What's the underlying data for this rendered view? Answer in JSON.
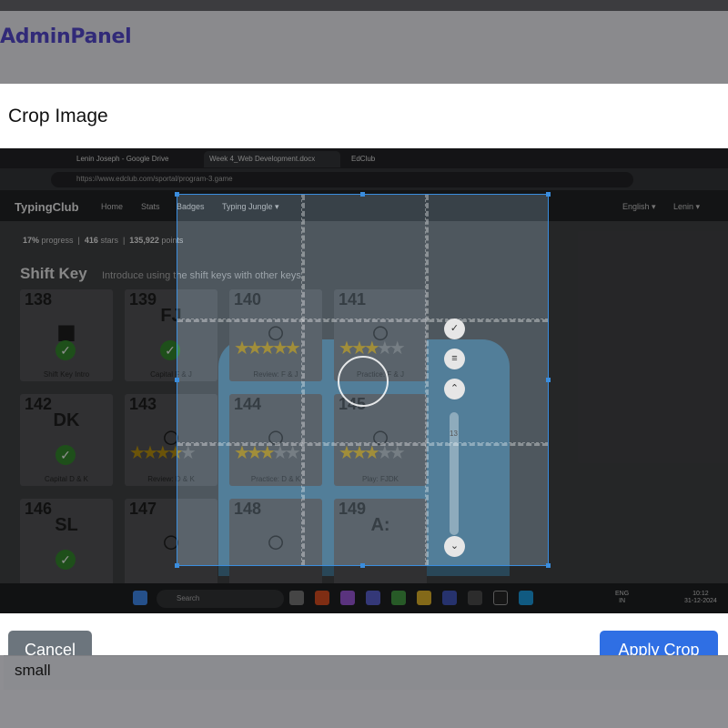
{
  "admin": {
    "brand": "AdminPanel"
  },
  "modal": {
    "title": "Crop Image",
    "cancel_label": "Cancel",
    "apply_label": "Apply Crop"
  },
  "background_field": {
    "value": "small"
  },
  "screenshot": {
    "tabs": [
      "Lenin Joseph - Google Drive",
      "Week 4_Web Development.docx",
      "EdClub"
    ],
    "url": "https://www.edclub.com/sportal/program-3.game",
    "site_name": "TypingClub",
    "nav": [
      "Home",
      "Stats",
      "Badges",
      "Typing Jungle ▾"
    ],
    "nav_right": [
      "English ▾",
      "Lenin ▾"
    ],
    "progress": {
      "percent": "17%",
      "percent_label": "progress",
      "stars": "416",
      "stars_label": "stars",
      "points": "135,922",
      "points_label": "points"
    },
    "section_title": "Shift Key",
    "section_subtitle": "Introduce using the shift keys with other keys",
    "cards": [
      {
        "num": "138",
        "caption": "Shift Key Intro",
        "abbr": "",
        "kind": "check",
        "stars": 0
      },
      {
        "num": "139",
        "caption": "Capital F & J",
        "abbr": "FJ",
        "kind": "check",
        "stars": 0
      },
      {
        "num": "140",
        "caption": "Review: F & J",
        "abbr": "",
        "kind": "stars",
        "stars": 5
      },
      {
        "num": "141",
        "caption": "Practice: F & J",
        "abbr": "",
        "kind": "stars",
        "stars": 3
      },
      {
        "num": "142",
        "caption": "Capital D & K",
        "abbr": "DK",
        "kind": "check",
        "stars": 0
      },
      {
        "num": "143",
        "caption": "Review: D & K",
        "abbr": "",
        "kind": "stars",
        "stars": 4
      },
      {
        "num": "144",
        "caption": "Practice: D & K",
        "abbr": "",
        "kind": "stars",
        "stars": 3
      },
      {
        "num": "145",
        "caption": "Play: FJDK",
        "abbr": "",
        "kind": "stars",
        "stars": 3
      },
      {
        "num": "146",
        "caption": "",
        "abbr": "SL",
        "kind": "check",
        "stars": 0
      },
      {
        "num": "147",
        "caption": "",
        "abbr": "",
        "kind": "none",
        "stars": 0
      },
      {
        "num": "148",
        "caption": "",
        "abbr": "",
        "kind": "none",
        "stars": 0
      },
      {
        "num": "149",
        "caption": "",
        "abbr": "A:",
        "kind": "none",
        "stars": 0
      }
    ],
    "taskbar": {
      "search_placeholder": "Search",
      "lang_top": "ENG",
      "lang_bottom": "IN",
      "time": "10:12",
      "date": "31-12-2024"
    },
    "crop_zoom_label": "13"
  },
  "colors": {
    "apply": "#2f6fe4",
    "cancel": "#6c757d",
    "brand": "#312a78",
    "crop": "#3a8dde"
  }
}
